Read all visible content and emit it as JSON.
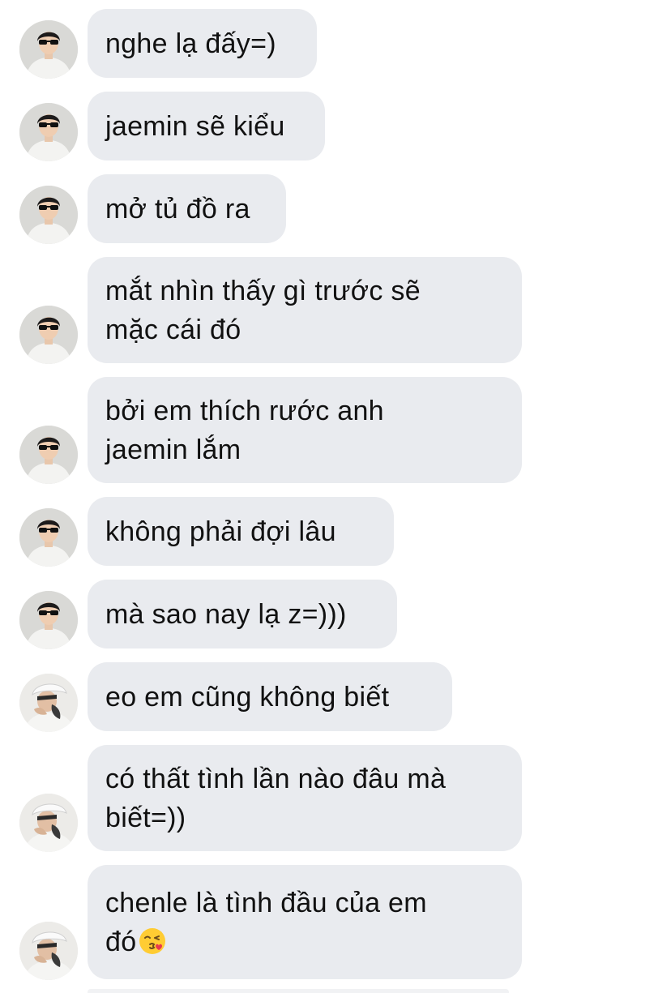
{
  "conversation": {
    "messages": [
      {
        "text": "nghe lạ đấy=)",
        "avatar": "avatar-sunglasses"
      },
      {
        "text": "jaemin sẽ kiểu",
        "avatar": "avatar-sunglasses"
      },
      {
        "text": "mở tủ đồ ra",
        "avatar": "avatar-sunglasses"
      },
      {
        "text": "mắt nhìn thấy gì trước sẽ\nmặc cái đó",
        "avatar": "avatar-sunglasses"
      },
      {
        "text": "bởi em thích rước anh\njaemin lắm",
        "avatar": "avatar-sunglasses"
      },
      {
        "text": "không phải đợi lâu",
        "avatar": "avatar-sunglasses"
      },
      {
        "text": "mà sao nay lạ z=)))",
        "avatar": "avatar-sunglasses"
      },
      {
        "text": "eo em cũng không biết",
        "avatar": "avatar-white-cap"
      },
      {
        "text": "có thất tình lần nào đâu mà\nbiết=))",
        "avatar": "avatar-white-cap"
      },
      {
        "text": "chenle là tình đầu của em\nđó",
        "avatar": "avatar-white-cap",
        "emoji": "face-blowing-kiss"
      }
    ]
  },
  "colors": {
    "bubble_background": "#e9ebef",
    "text": "#111111",
    "page_background": "#ffffff"
  }
}
